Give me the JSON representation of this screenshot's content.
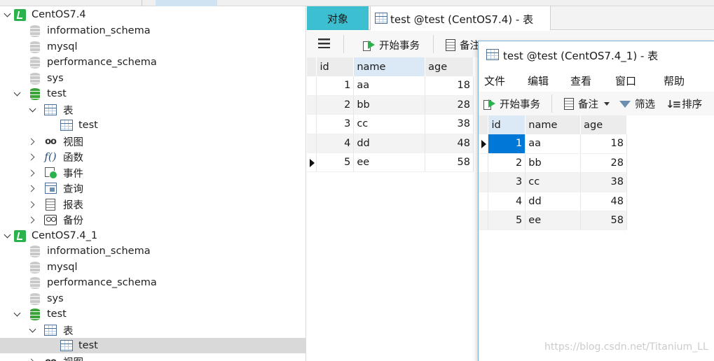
{
  "tree": {
    "items": [
      {
        "label": "CentOS7.4",
        "icon": "connection-icon"
      },
      {
        "label": "information_schema",
        "icon": "database-icon"
      },
      {
        "label": "mysql",
        "icon": "database-icon"
      },
      {
        "label": "performance_schema",
        "icon": "database-icon"
      },
      {
        "label": "sys",
        "icon": "database-icon"
      },
      {
        "label": "test",
        "icon": "database-open-icon"
      },
      {
        "label": "表",
        "icon": "tables-icon"
      },
      {
        "label": "test",
        "icon": "table-icon"
      },
      {
        "label": "视图",
        "icon": "views-icon",
        "glyph": "oo"
      },
      {
        "label": "函数",
        "icon": "functions-icon",
        "glyph": "f()"
      },
      {
        "label": "事件",
        "icon": "events-icon"
      },
      {
        "label": "查询",
        "icon": "queries-icon"
      },
      {
        "label": "报表",
        "icon": "reports-icon"
      },
      {
        "label": "备份",
        "icon": "backups-icon"
      },
      {
        "label": "CentOS7.4_1",
        "icon": "connection-icon"
      },
      {
        "label": "information_schema",
        "icon": "database-icon"
      },
      {
        "label": "mysql",
        "icon": "database-icon"
      },
      {
        "label": "performance_schema",
        "icon": "database-icon"
      },
      {
        "label": "sys",
        "icon": "database-icon"
      },
      {
        "label": "test",
        "icon": "database-open-icon"
      },
      {
        "label": "表",
        "icon": "tables-icon"
      },
      {
        "label": "test",
        "icon": "table-icon"
      },
      {
        "label": "视图",
        "icon": "views-icon",
        "glyph": "oo"
      }
    ]
  },
  "back_window": {
    "tab_objects": "对象",
    "tab_title": "test @test (CentOS7.4) - 表",
    "toolbar": {
      "begin_transaction": "开始事务",
      "memo": "备注"
    },
    "columns": [
      "id",
      "name",
      "age"
    ],
    "rows": [
      {
        "id": "1",
        "name": "aa",
        "age": "18"
      },
      {
        "id": "2",
        "name": "bb",
        "age": "28"
      },
      {
        "id": "3",
        "name": "cc",
        "age": "38"
      },
      {
        "id": "4",
        "name": "dd",
        "age": "48"
      },
      {
        "id": "5",
        "name": "ee",
        "age": "58"
      }
    ]
  },
  "front_window": {
    "title": "test @test (CentOS7.4_1) - 表",
    "menu": {
      "file": "文件",
      "edit": "编辑",
      "view": "查看",
      "window": "窗口",
      "help": "帮助"
    },
    "toolbar": {
      "begin_transaction": "开始事务",
      "memo": "备注",
      "filter": "筛选",
      "sort": "排序"
    },
    "columns": [
      "id",
      "name",
      "age"
    ],
    "rows": [
      {
        "id": "1",
        "name": "aa",
        "age": "18"
      },
      {
        "id": "2",
        "name": "bb",
        "age": "28"
      },
      {
        "id": "3",
        "name": "cc",
        "age": "38"
      },
      {
        "id": "4",
        "name": "dd",
        "age": "48"
      },
      {
        "id": "5",
        "name": "ee",
        "age": "58"
      }
    ]
  },
  "watermark": "https://blog.csdn.net/Titanium_LL",
  "colors": {
    "accent_tab": "#3cbfd0",
    "selection": "#0078d7",
    "connection_green": "#2bb24c"
  }
}
